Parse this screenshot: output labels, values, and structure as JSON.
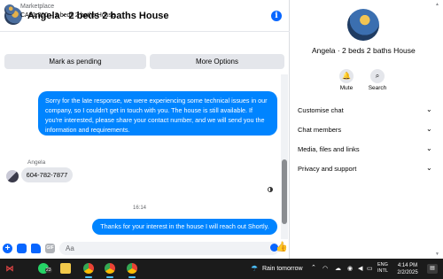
{
  "chat": {
    "header": {
      "title": "Angela · 2 beds 2 baths House",
      "info_icon": "info-icon"
    },
    "marketplace": {
      "label": "Marketplace",
      "listing": "CA$1,300 – 2 beds 2 baths House",
      "mark_pending": "Mark as pending",
      "more_options": "More Options"
    },
    "messages": [
      {
        "from": "me",
        "text": "Sorry for the late response, we were experiencing some technical issues in our company, so I couldn't get in touch with you. The house is still available. If you're interested, please share your contact number, and we will send you the information and requirements."
      },
      {
        "from": "Angela",
        "sender_label": "Angela",
        "text": "604-782-7877"
      },
      {
        "timestamp": "16:14"
      },
      {
        "from": "me",
        "text": "Thanks for your interest in the house I will reach out Shortly."
      }
    ],
    "composer": {
      "placeholder": "Aa",
      "gif_label": "GIF"
    }
  },
  "info_panel": {
    "title": "Angela · 2 beds 2 baths House",
    "actions": [
      {
        "label": "Mute",
        "icon": "bell-icon"
      },
      {
        "label": "Search",
        "icon": "search-icon"
      }
    ],
    "sections": [
      "Customise chat",
      "Chat members",
      "Media, files and links",
      "Privacy and support"
    ]
  },
  "taskbar": {
    "whatsapp_badge": "23",
    "weather": "Rain tomorrow",
    "lang_line1": "ENG",
    "lang_line2": "INTL",
    "time": "4:14 PM",
    "date": "2/2/2025"
  },
  "colors": {
    "accent": "#0084ff",
    "brand": "#0866ff",
    "bubble_in": "#e4e6eb",
    "taskbar": "#1b1b1b"
  }
}
